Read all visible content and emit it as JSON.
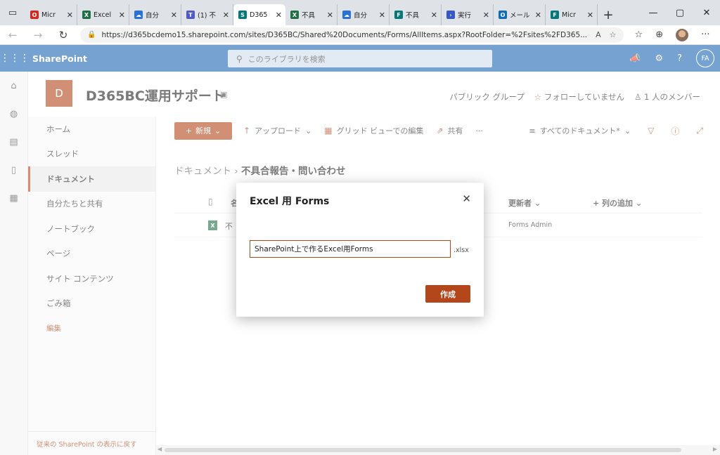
{
  "browser": {
    "tabs": [
      {
        "title": "Micr",
        "color": "#d9261c",
        "glyph": "O"
      },
      {
        "title": "Excel",
        "color": "#1e7145",
        "glyph": "X"
      },
      {
        "title": "自分",
        "color": "#2872d7",
        "glyph": "☁"
      },
      {
        "title": "(1) 不",
        "color": "#5059c9",
        "glyph": "T"
      },
      {
        "title": "D365",
        "color": "#03787c",
        "glyph": "S",
        "active": true
      },
      {
        "title": "不具",
        "color": "#1e7145",
        "glyph": "X"
      },
      {
        "title": "自分",
        "color": "#2872d7",
        "glyph": "☁"
      },
      {
        "title": "不具",
        "color": "#03787c",
        "glyph": "F"
      },
      {
        "title": "実行",
        "color": "#3557c9",
        "glyph": "›"
      },
      {
        "title": "メール",
        "color": "#0f6cbd",
        "glyph": "O"
      },
      {
        "title": "Micr",
        "color": "#03787c",
        "glyph": "F"
      }
    ],
    "url": "https://d365bcdemo15.sharepoint.com/sites/D365BC/Shared%20Documents/Forms/AllItems.aspx?RootFolder=%2Fsites%2FD365..."
  },
  "suite": {
    "brand": "SharePoint",
    "search_placeholder": "このライブラリを検索",
    "user_initials": "FA"
  },
  "site": {
    "logo_letter": "D",
    "title": "D365BC運用サポート",
    "group": "パブリック グループ",
    "follow": "フォローしていません",
    "members": "1 人のメンバー"
  },
  "nav": {
    "items": [
      "ホーム",
      "スレッド",
      "ドキュメント",
      "自分たちと共有",
      "ノートブック",
      "ページ",
      "サイト コンテンツ",
      "ごみ箱"
    ],
    "edit": "編集",
    "classic": "従来の SharePoint の表示に戻す"
  },
  "commands": {
    "new": "新規",
    "upload": "アップロード",
    "grid_edit": "グリッド ビューでの編集",
    "share": "共有",
    "more": "···",
    "views": "すべてのドキュメント*"
  },
  "breadcrumb": {
    "root": "ドキュメント",
    "current": "不具合報告・問い合わせ"
  },
  "list": {
    "col_name": "名",
    "col_modified_by": "更新者",
    "col_add": "列の追加",
    "row_name": "不",
    "row_modified_by": "Forms Admin"
  },
  "dialog": {
    "title": "Excel 用 Forms",
    "input_value": "SharePoint上で作るExcel用Forms",
    "extension": ".xlsx",
    "create": "作成"
  }
}
